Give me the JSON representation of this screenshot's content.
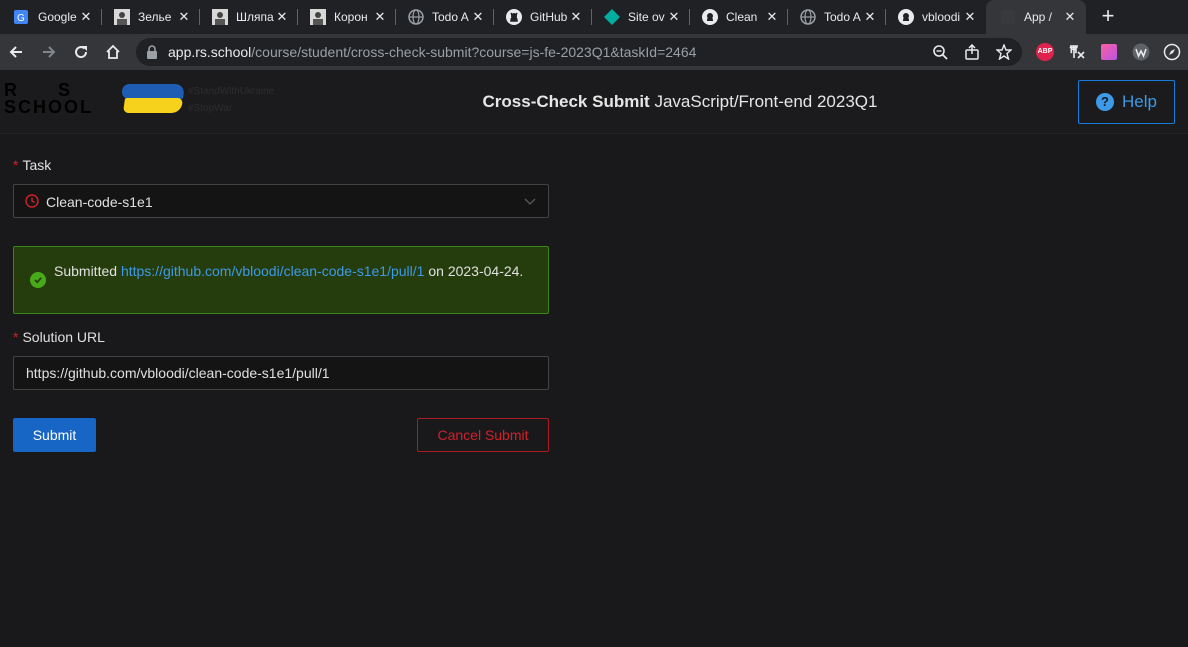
{
  "browser": {
    "tabs": [
      {
        "title": "Google",
        "icon": "google-translate-icon"
      },
      {
        "title": "Зелье",
        "icon": "portrait-icon"
      },
      {
        "title": "Шляпа",
        "icon": "portrait-icon"
      },
      {
        "title": "Корон",
        "icon": "portrait-icon"
      },
      {
        "title": "Todo A",
        "icon": "globe-icon"
      },
      {
        "title": "GitHub",
        "icon": "github-icon"
      },
      {
        "title": "Site ov",
        "icon": "diamond-icon"
      },
      {
        "title": "Clean",
        "icon": "github-icon"
      },
      {
        "title": "Todo A",
        "icon": "globe-icon"
      },
      {
        "title": "vbloodi",
        "icon": "github-icon"
      },
      {
        "title": "App /",
        "icon": "rs-icon"
      }
    ],
    "url_host": "app.rs.school",
    "url_path": "/course/student/cross-check-submit?course=js-fe-2023Q1&taskId=2464",
    "extensions": [
      {
        "name": "adblock-icon",
        "label": "ABP",
        "color": "#e0234c"
      },
      {
        "name": "translate-ext-icon",
        "label": "",
        "color": "#e8eaed"
      },
      {
        "name": "gradient-ext-icon",
        "label": "",
        "color": "#e040a0"
      },
      {
        "name": "w-ext-icon",
        "label": "",
        "color": "#e8eaed"
      },
      {
        "name": "compass-icon",
        "label": "",
        "color": "#e8eaed"
      }
    ]
  },
  "header": {
    "logo_line1": "R S",
    "logo_line2": "SCHOOL",
    "tag1": "#StandWithUkraine",
    "tag2": "#StopWar",
    "title_bold": "Cross-Check Submit",
    "title_rest": "JavaScript/Front-end 2023Q1",
    "help_label": "Help"
  },
  "form": {
    "task_label": "Task",
    "task_value": "Clean-code-s1e1",
    "alert_prefix": "Submitted",
    "alert_link": "https://github.com/vbloodi/clean-code-s1e1/pull/1",
    "alert_suffix": "on",
    "alert_date": "2023-04-24.",
    "url_label": "Solution URL",
    "url_value": "https://github.com/vbloodi/clean-code-s1e1/pull/1",
    "submit_label": "Submit",
    "cancel_label": "Cancel Submit"
  },
  "colors": {
    "accent": "#177ddc",
    "success": "#49aa19",
    "danger": "#d32029"
  }
}
